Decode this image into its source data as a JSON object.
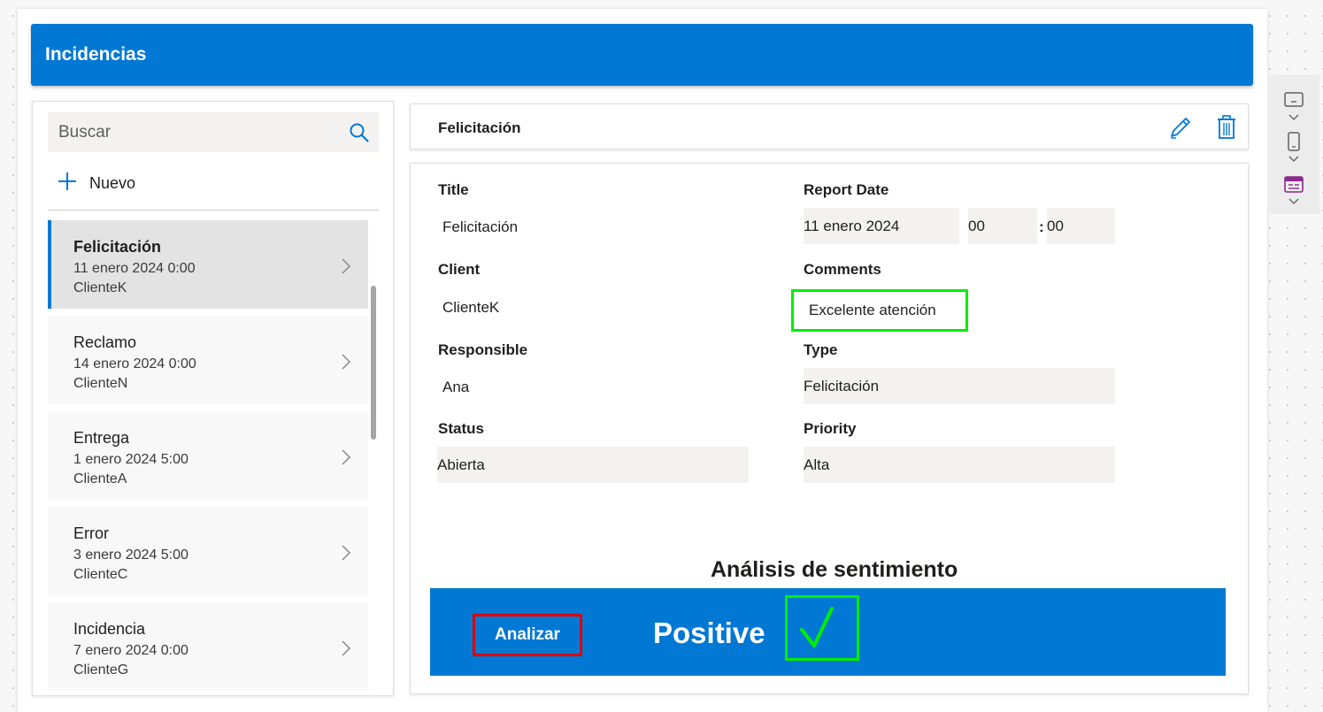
{
  "header": {
    "title": "Incidencias"
  },
  "search": {
    "placeholder": "Buscar"
  },
  "new_button": {
    "label": "Nuevo"
  },
  "list": [
    {
      "title": "Felicitación",
      "date": "11 enero 2024 0:00",
      "client": "ClienteK",
      "selected": true
    },
    {
      "title": "Reclamo",
      "date": "14 enero 2024 0:00",
      "client": "ClienteN"
    },
    {
      "title": "Entrega",
      "date": "1 enero 2024 5:00",
      "client": "ClienteA"
    },
    {
      "title": "Error",
      "date": "3 enero 2024 5:00",
      "client": "ClienteC"
    },
    {
      "title": "Incidencia",
      "date": "7 enero 2024 0:00",
      "client": "ClienteG"
    }
  ],
  "detail": {
    "title": "Felicitación",
    "fields": {
      "title_label": "Title",
      "title_value": "Felicitación",
      "report_date_label": "Report Date",
      "report_date_value": "11 enero 2024",
      "hour": "00",
      "minute": "00",
      "time_separator": ":",
      "client_label": "Client",
      "client_value": "ClienteK",
      "comments_label": "Comments",
      "comments_value": "Excelente atención",
      "responsible_label": "Responsible",
      "responsible_value": "Ana",
      "type_label": "Type",
      "type_value": "Felicitación",
      "status_label": "Status",
      "status_value": "Abierta",
      "priority_label": "Priority",
      "priority_value": "Alta"
    }
  },
  "sentiment": {
    "title": "Análisis de sentimiento",
    "analyze_label": "Analizar",
    "result": "Positive"
  },
  "colors": {
    "accent": "#0078d4",
    "highlight_green": "#00ee00",
    "highlight_red": "#e00000"
  },
  "icons": {
    "search": "search-icon",
    "add": "plus-icon",
    "chevron": "chevron-right-icon",
    "edit": "pencil-icon",
    "delete": "trash-icon",
    "check": "checkmark-icon",
    "toolbar": [
      "tablet-layout-icon",
      "phone-layout-icon",
      "form-layout-icon"
    ]
  }
}
